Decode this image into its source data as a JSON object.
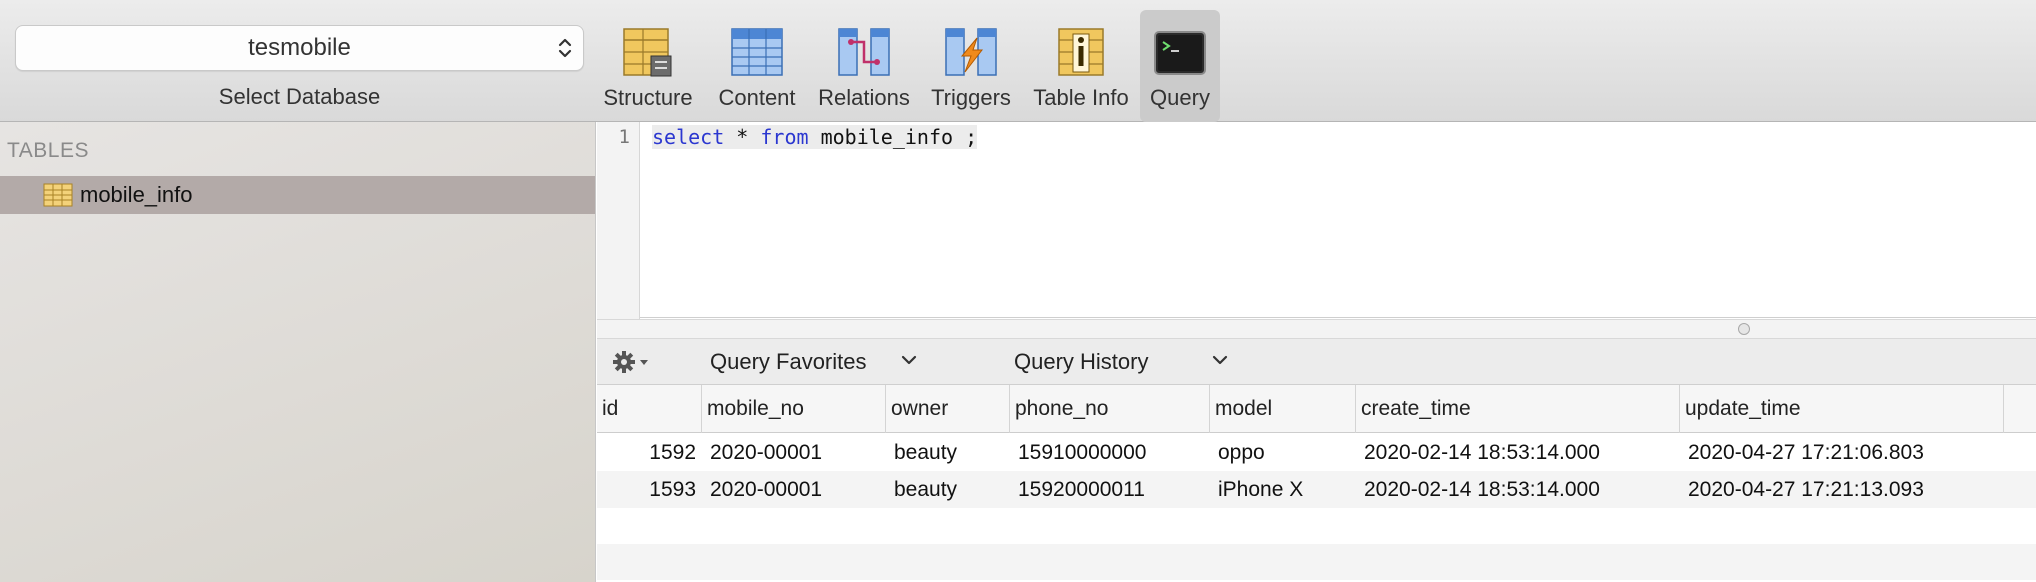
{
  "toolbar": {
    "database": "tesmobile",
    "database_label": "Select Database",
    "buttons": [
      {
        "label": "Structure",
        "icon": "structure-icon"
      },
      {
        "label": "Content",
        "icon": "content-icon"
      },
      {
        "label": "Relations",
        "icon": "relations-icon"
      },
      {
        "label": "Triggers",
        "icon": "triggers-icon"
      },
      {
        "label": "Table Info",
        "icon": "table-info-icon"
      },
      {
        "label": "Query",
        "icon": "terminal-icon",
        "active": true
      }
    ]
  },
  "sidebar": {
    "heading": "TABLES",
    "tables": [
      {
        "name": "mobile_info",
        "selected": true
      }
    ]
  },
  "editor": {
    "line_number": "1",
    "query": {
      "kw1": "select",
      "star": " * ",
      "kw2": "from",
      "rest": " mobile_info ;"
    }
  },
  "querybar": {
    "favorites_label": "Query Favorites",
    "history_label": "Query History"
  },
  "results": {
    "columns": [
      "id",
      "mobile_no",
      "owner",
      "phone_no",
      "model",
      "create_time",
      "update_time"
    ],
    "rows": [
      [
        "1592",
        "2020-00001",
        "beauty",
        "15910000000",
        "oppo",
        "2020-02-14 18:53:14.000",
        "2020-04-27 17:21:06.803"
      ],
      [
        "1593",
        "2020-00001",
        "beauty",
        "15920000011",
        "iPhone X",
        "2020-02-14 18:53:14.000",
        "2020-04-27 17:21:13.093"
      ]
    ]
  },
  "colors": {
    "selection": "#b3aaa8",
    "keyword": "#2b37d0",
    "active_tab": "#cbcbcb"
  }
}
